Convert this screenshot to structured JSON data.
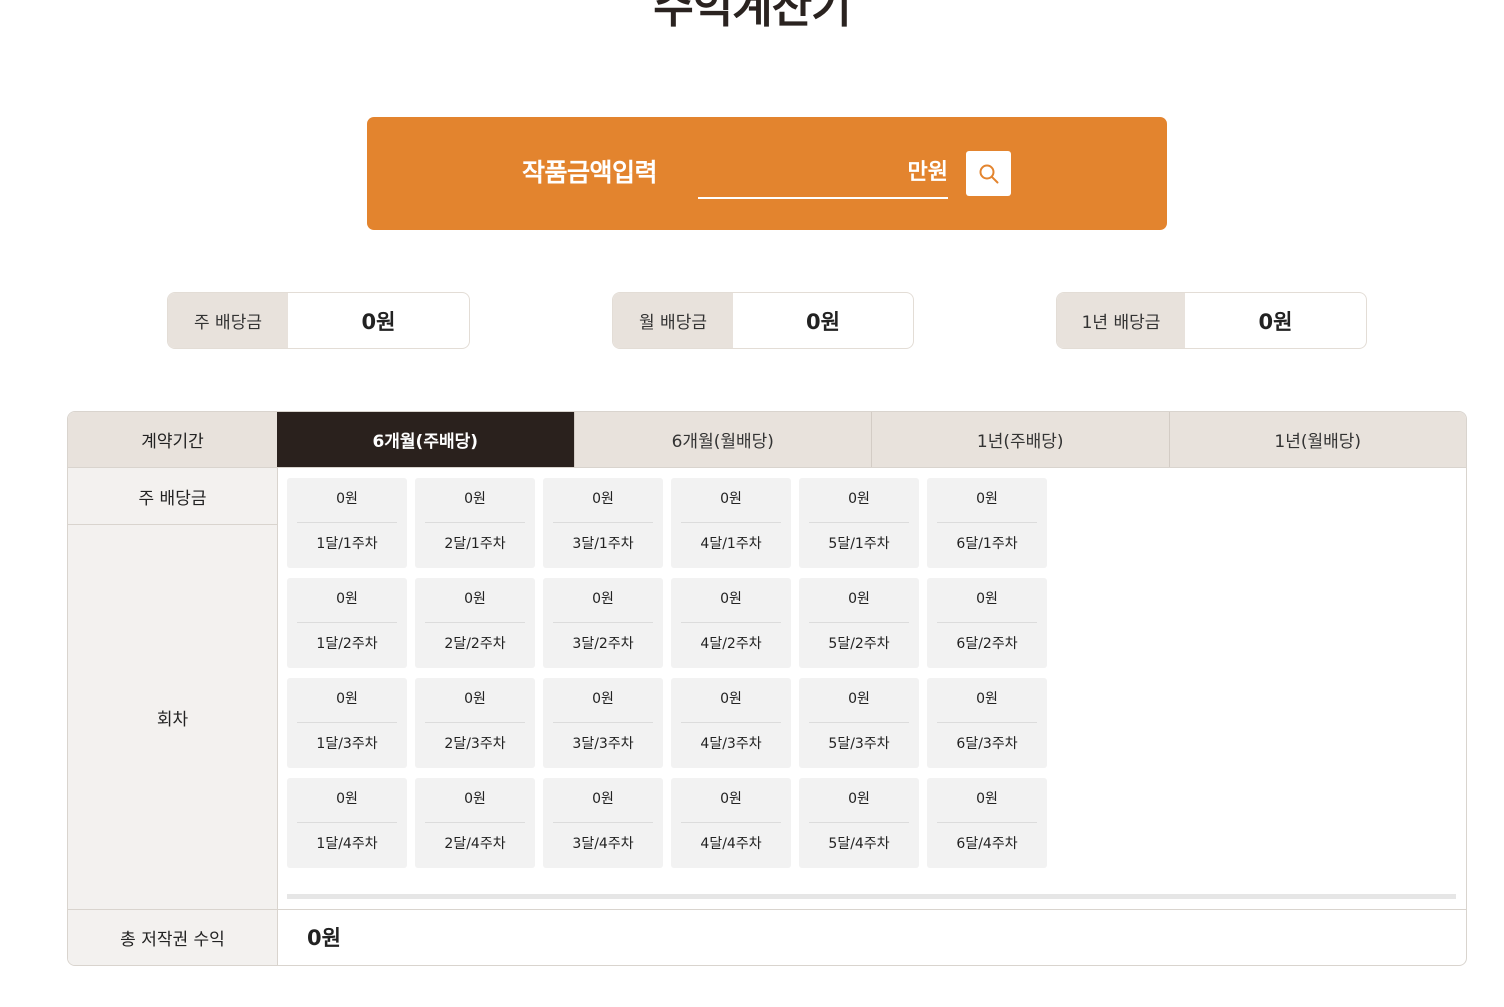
{
  "page": {
    "title": "수익계산기"
  },
  "search": {
    "label": "작품금액입력",
    "value": "",
    "placeholder": "",
    "unit": "만원",
    "button_icon": "search-icon",
    "accent_color": "#e3842e"
  },
  "summary": [
    {
      "label": "주 배당금",
      "value": "0원"
    },
    {
      "label": "월 배당금",
      "value": "0원"
    },
    {
      "label": "1년 배당금",
      "value": "0원"
    }
  ],
  "table": {
    "period_header": "계약기간",
    "weekly_header": "주 배당금",
    "round_header": "회차",
    "total_header": "총 저작권 수익",
    "total_value": "0원",
    "tabs": [
      {
        "label": "6개월(주배당)",
        "active": true
      },
      {
        "label": "6개월(월배당)",
        "active": false
      },
      {
        "label": "1년(주배당)",
        "active": false
      },
      {
        "label": "1년(월배당)",
        "active": false
      }
    ],
    "rows": [
      [
        {
          "amount": "0원",
          "label": "1달/1주차"
        },
        {
          "amount": "0원",
          "label": "2달/1주차"
        },
        {
          "amount": "0원",
          "label": "3달/1주차"
        },
        {
          "amount": "0원",
          "label": "4달/1주차"
        },
        {
          "amount": "0원",
          "label": "5달/1주차"
        },
        {
          "amount": "0원",
          "label": "6달/1주차"
        }
      ],
      [
        {
          "amount": "0원",
          "label": "1달/2주차"
        },
        {
          "amount": "0원",
          "label": "2달/2주차"
        },
        {
          "amount": "0원",
          "label": "3달/2주차"
        },
        {
          "amount": "0원",
          "label": "4달/2주차"
        },
        {
          "amount": "0원",
          "label": "5달/2주차"
        },
        {
          "amount": "0원",
          "label": "6달/2주차"
        }
      ],
      [
        {
          "amount": "0원",
          "label": "1달/3주차"
        },
        {
          "amount": "0원",
          "label": "2달/3주차"
        },
        {
          "amount": "0원",
          "label": "3달/3주차"
        },
        {
          "amount": "0원",
          "label": "4달/3주차"
        },
        {
          "amount": "0원",
          "label": "5달/3주차"
        },
        {
          "amount": "0원",
          "label": "6달/3주차"
        }
      ],
      [
        {
          "amount": "0원",
          "label": "1달/4주차"
        },
        {
          "amount": "0원",
          "label": "2달/4주차"
        },
        {
          "amount": "0원",
          "label": "3달/4주차"
        },
        {
          "amount": "0원",
          "label": "4달/4주차"
        },
        {
          "amount": "0원",
          "label": "5달/4주차"
        },
        {
          "amount": "0원",
          "label": "6달/4주차"
        }
      ]
    ]
  }
}
